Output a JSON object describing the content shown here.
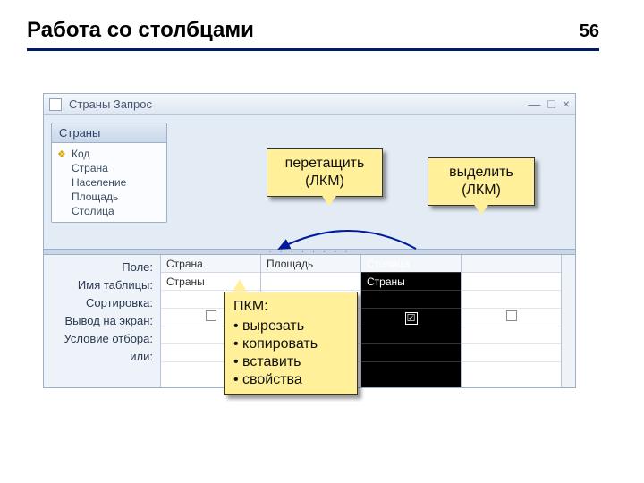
{
  "page_number": "56",
  "title": "Работа со столбцами",
  "window": {
    "title": "Страны Запрос",
    "field_list": {
      "header": "Страны",
      "fields": [
        "Код",
        "Страна",
        "Население",
        "Площадь",
        "Столица"
      ]
    },
    "grid": {
      "row_labels": [
        "Поле:",
        "Имя таблицы:",
        "Сортировка:",
        "Вывод на экран:",
        "Условие отбора:",
        "или:"
      ],
      "columns": [
        {
          "field": "Страна",
          "table": "Страны",
          "selected": false
        },
        {
          "field": "Площадь",
          "table": "",
          "selected": false
        },
        {
          "field": "Столица",
          "table": "Страны",
          "selected": true
        }
      ]
    }
  },
  "callouts": {
    "drag": {
      "line1": "перетащить",
      "line2": "(ЛКМ)"
    },
    "select": {
      "line1": "выделить",
      "line2": "(ЛКМ)"
    },
    "context": {
      "header": "ПКМ:",
      "items": [
        "вырезать",
        "копировать",
        "вставить",
        "свойства"
      ]
    }
  }
}
